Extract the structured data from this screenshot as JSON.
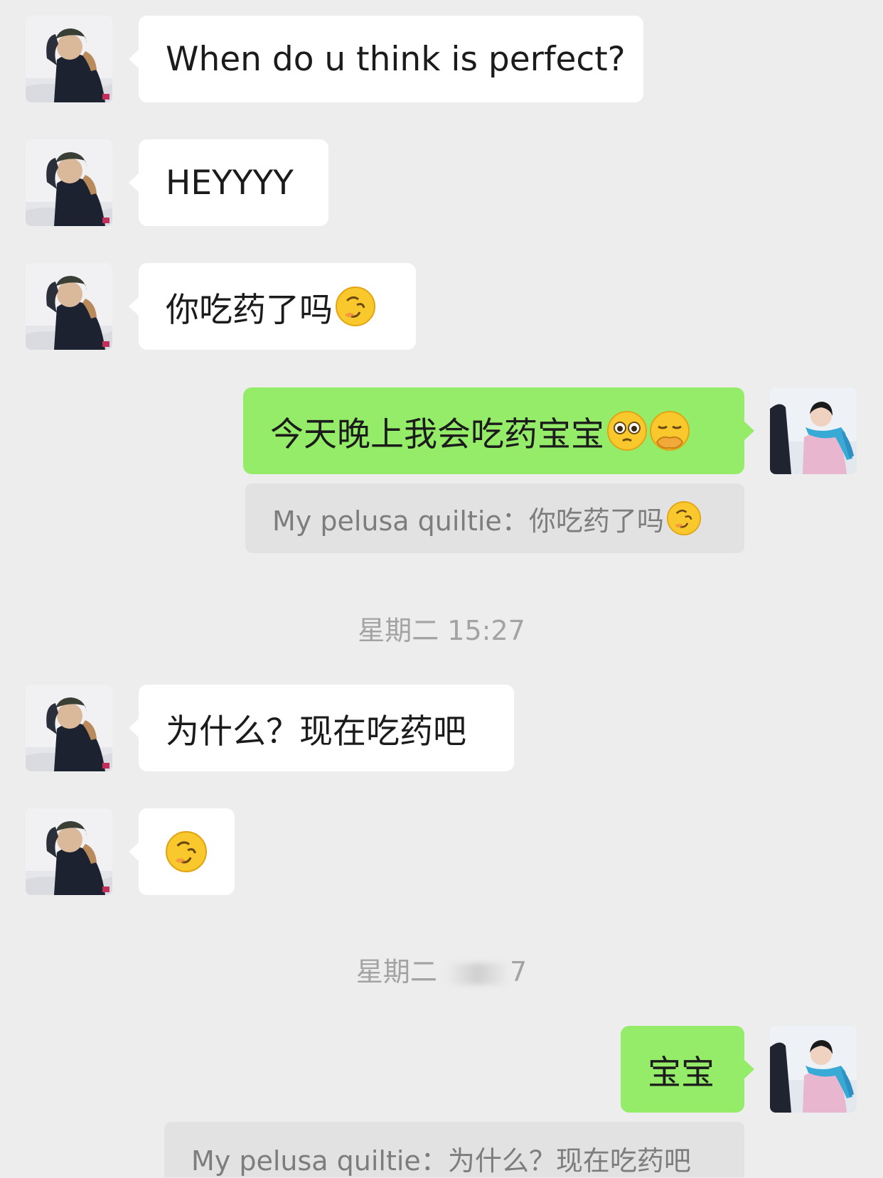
{
  "contact_name": "My pelusa quiltie",
  "messages": [
    {
      "side": "in",
      "text": "When do u think is perfect?",
      "emojis": []
    },
    {
      "side": "in",
      "text": "HEYYYY",
      "emojis": []
    },
    {
      "side": "in",
      "text": "你吃药了吗",
      "emojis": [
        "smirk-emoji"
      ]
    },
    {
      "side": "out",
      "text": "今天晚上我会吃药宝宝",
      "emojis": [
        "pleading-emoji",
        "hand-over-mouth-emoji"
      ]
    },
    {
      "side": "in",
      "text": "为什么？现在吃药吧",
      "emojis": []
    },
    {
      "side": "in",
      "text": "",
      "emojis": [
        "smirk-emoji"
      ]
    },
    {
      "side": "out",
      "text": "宝宝",
      "emojis": []
    }
  ],
  "quotes": [
    {
      "text": "My pelusa quiltie：你吃药了吗",
      "emojis": [
        "smirk-emoji"
      ]
    },
    {
      "text": "My pelusa quiltie：为什么？现在吃药吧",
      "emojis": []
    }
  ],
  "timestamps": [
    {
      "day": "星期二",
      "time": "15:27"
    },
    {
      "day": "星期二",
      "time": "7",
      "obscured": true
    }
  ],
  "colors": {
    "background": "#ededed",
    "incoming_bubble": "#ffffff",
    "outgoing_bubble": "#95ec69",
    "quote_bg": "#e2e2e2",
    "timestamp_text": "#a3a3a3"
  }
}
